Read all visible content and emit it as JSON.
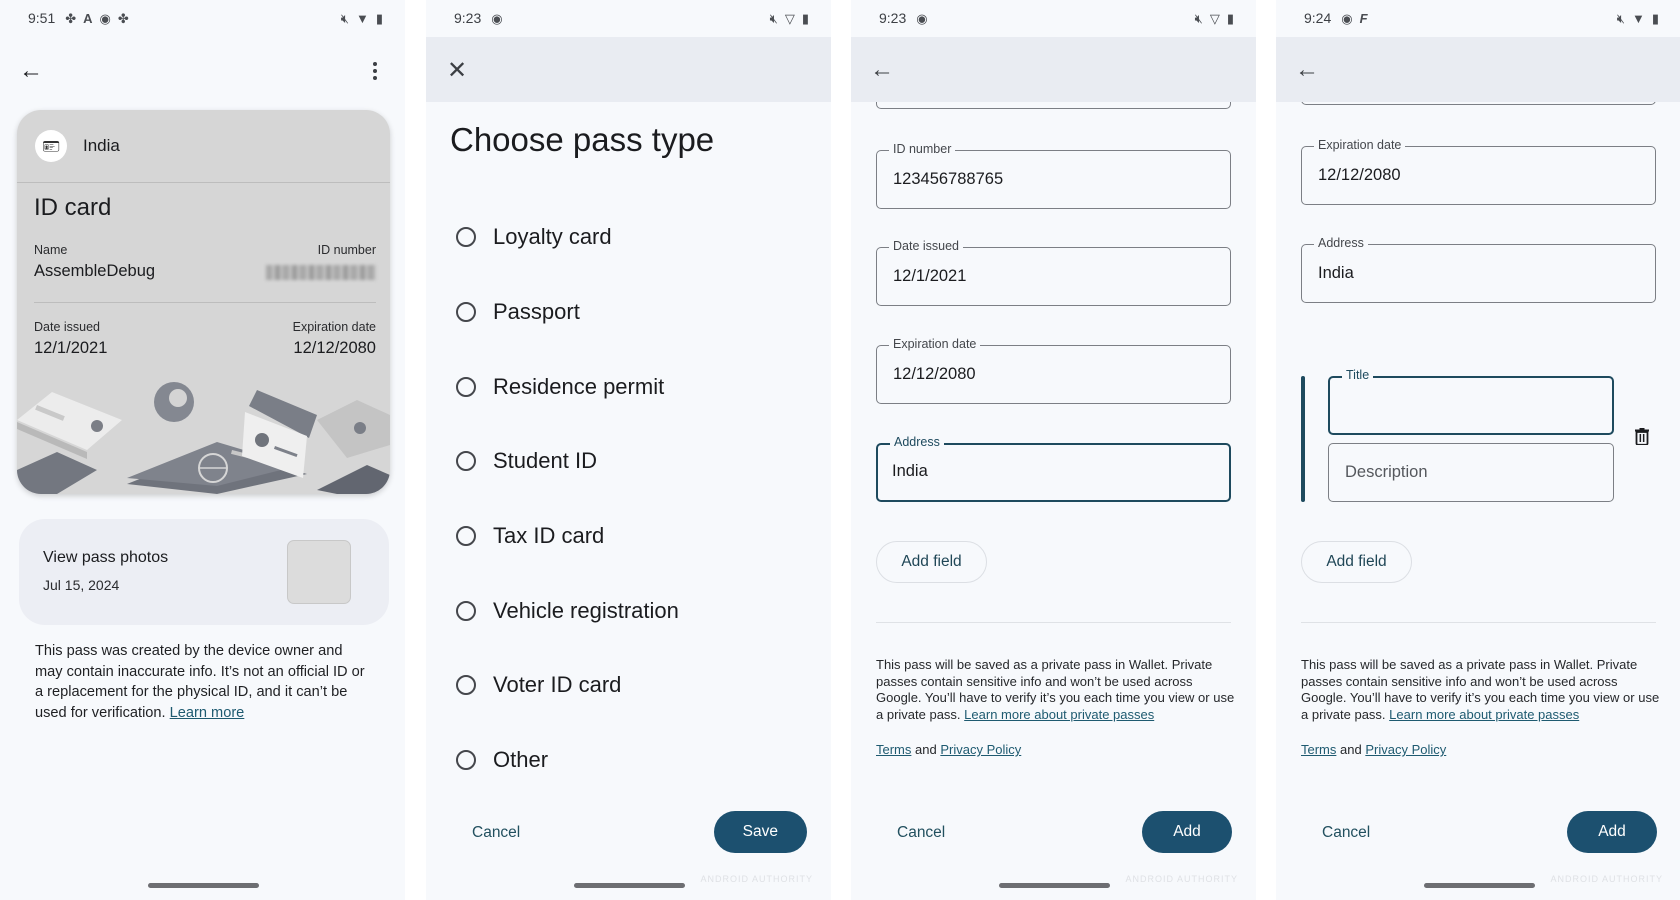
{
  "panels": [
    {
      "status": {
        "time": "9:51",
        "left_icons": [
          "fan-icon",
          "a-icon",
          "record-icon",
          "fan-icon"
        ],
        "right_icons": [
          "mute-icon",
          "wifi-icon",
          "battery-icon"
        ]
      },
      "appbar": {
        "nav_icon": "back-arrow-icon",
        "menu_icon": "more-vert-icon"
      },
      "card": {
        "issuer": "India",
        "issuer_icon": "id-card-icon",
        "title": "ID card",
        "name_label": "Name",
        "name_value": "AssembleDebug",
        "id_label": "ID number",
        "id_value_blurred": true,
        "issued_label": "Date issued",
        "issued_value": "12/1/2021",
        "expiry_label": "Expiration date",
        "expiry_value": "12/12/2080"
      },
      "photos": {
        "title": "View pass photos",
        "date": "Jul 15, 2024"
      },
      "disclaimer": "This pass was created by the device owner and may contain inaccurate info. It’s not an official ID or a replacement for the physical ID, and it can’t be used for verification.",
      "learn_more": "Learn more"
    },
    {
      "status": {
        "time": "9:23",
        "left_icons": [
          "record-icon"
        ],
        "right_icons": [
          "mute-icon",
          "wifi-icon",
          "battery-icon"
        ]
      },
      "appbar": {
        "nav_icon": "close-icon"
      },
      "title": "Choose pass type",
      "options": [
        "Loyalty card",
        "Passport",
        "Residence permit",
        "Student ID",
        "Tax ID card",
        "Vehicle registration",
        "Voter ID card",
        "Other"
      ],
      "selected": null,
      "cancel": "Cancel",
      "primary": "Save"
    },
    {
      "status": {
        "time": "9:23",
        "left_icons": [
          "record-icon"
        ],
        "right_icons": [
          "mute-icon",
          "wifi-icon",
          "battery-icon"
        ]
      },
      "appbar": {
        "nav_icon": "back-arrow-icon"
      },
      "fields": [
        {
          "label": "ID number",
          "value": "123456788765",
          "focused": false
        },
        {
          "label": "Date issued",
          "value": "12/1/2021",
          "focused": false
        },
        {
          "label": "Expiration date",
          "value": "12/12/2080",
          "focused": false
        },
        {
          "label": "Address",
          "value": "India",
          "focused": true
        }
      ],
      "add_field": "Add field",
      "privacy_text": "This pass will be saved as a private pass in Wallet. Private passes contain sensitive info and won’t be used across Google. You’ll have to verify it’s you each time you view or use a private pass.",
      "privacy_link": "Learn more about private passes",
      "terms": "Terms",
      "and": "and",
      "privacy_policy": "Privacy Policy",
      "cancel": "Cancel",
      "primary": "Add"
    },
    {
      "status": {
        "time": "9:24",
        "left_icons": [
          "record-icon",
          "f-icon"
        ],
        "right_icons": [
          "mute-icon",
          "wifi-icon",
          "battery-icon"
        ]
      },
      "appbar": {
        "nav_icon": "back-arrow-icon"
      },
      "fields": [
        {
          "label": "Expiration date",
          "value": "12/12/2080",
          "focused": false
        },
        {
          "label": "Address",
          "value": "India",
          "focused": false
        }
      ],
      "custom_field": {
        "title_label": "Title",
        "title_value": "",
        "description_placeholder": "Description"
      },
      "add_field": "Add field",
      "privacy_text": "This pass will be saved as a private pass in Wallet. Private passes contain sensitive info and won’t be used across Google. You’ll have to verify it’s you each time you view or use a private pass.",
      "privacy_link": "Learn more about private passes",
      "terms": "Terms",
      "and": "and",
      "privacy_policy": "Privacy Policy",
      "cancel": "Cancel",
      "primary": "Add"
    }
  ],
  "watermark": "ANDROID AUTHORITY",
  "colors": {
    "primary": "#1c506f",
    "focus": "#1e4a5e",
    "background": "#f7f9fc",
    "appbar": "#e9ecf2",
    "link": "#1e5a70"
  }
}
